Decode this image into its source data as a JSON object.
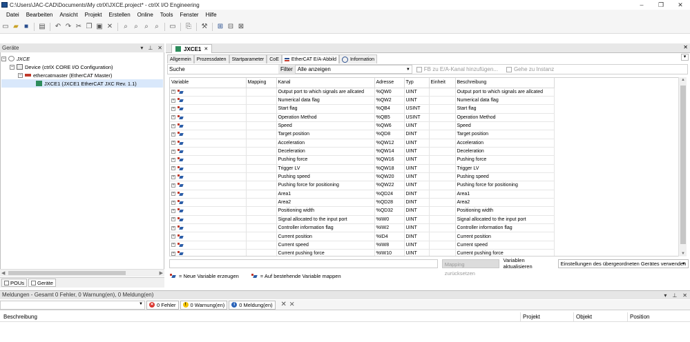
{
  "window": {
    "title": "C:\\Users\\JAC-CAD\\Documents\\My ctrlX\\JXCE.project* - ctrlX I/O Engineering",
    "controls": [
      "–",
      "❐",
      "✕"
    ]
  },
  "menu": [
    "Datei",
    "Bearbeiten",
    "Ansicht",
    "Projekt",
    "Erstellen",
    "Online",
    "Tools",
    "Fenster",
    "Hilfe"
  ],
  "devices_pane": {
    "title": "Geräte",
    "tree": [
      {
        "label": "JXCE",
        "icon": "project-icon"
      },
      {
        "label": "Device (ctrlX CORE I/O Configuration)",
        "icon": "device-icon"
      },
      {
        "label": "ethercatmaster (EtherCAT Master)",
        "icon": "ethercat-master-icon"
      },
      {
        "label": "JXCE1 (JXCE1 EtherCAT JXC Rev. 1.1)",
        "icon": "slave-icon"
      }
    ],
    "bottom_tabs": [
      "POUs",
      "Geräte"
    ]
  },
  "editor": {
    "doc_tab": "JXCE1",
    "subtabs": [
      "Allgemein",
      "Prozessdaten",
      "Startparameter",
      "CoE",
      "EtherCAT E/A-Abbild",
      "Information"
    ],
    "active_subtab": "EtherCAT E/A-Abbild",
    "search_label": "Suche",
    "filter_label": "Filter",
    "filter_value": "Alle anzeigen",
    "add_fb_button": "FB zu E/A-Kanal hinzufügen...",
    "goto_instance_button": "Gehe zu Instanz",
    "columns": [
      "Variable",
      "Mapping",
      "Kanal",
      "Adresse",
      "Typ",
      "Einheit",
      "Beschreibung"
    ],
    "rows": [
      {
        "kanal": "Output port to which signals are allcated",
        "adresse": "%QW0",
        "typ": "UINT",
        "beschreibung": "Output port to which signals are allcated"
      },
      {
        "kanal": "Numerical data flag",
        "adresse": "%QW2",
        "typ": "UINT",
        "beschreibung": "Numerical data flag"
      },
      {
        "kanal": "Start flag",
        "adresse": "%QB4",
        "typ": "USINT",
        "beschreibung": "Start flag"
      },
      {
        "kanal": "Operation Method",
        "adresse": "%QB5",
        "typ": "USINT",
        "beschreibung": "Operation Method"
      },
      {
        "kanal": "Speed",
        "adresse": "%QW6",
        "typ": "UINT",
        "beschreibung": "Speed"
      },
      {
        "kanal": "Target position",
        "adresse": "%QD8",
        "typ": "DINT",
        "beschreibung": "Target position"
      },
      {
        "kanal": "Acceleration",
        "adresse": "%QW12",
        "typ": "UINT",
        "beschreibung": "Acceleration"
      },
      {
        "kanal": "Deceleration",
        "adresse": "%QW14",
        "typ": "UINT",
        "beschreibung": "Deceleration"
      },
      {
        "kanal": "Pushing force",
        "adresse": "%QW16",
        "typ": "UINT",
        "beschreibung": "Pushing force"
      },
      {
        "kanal": "Trigger LV",
        "adresse": "%QW18",
        "typ": "UINT",
        "beschreibung": "Trigger LV"
      },
      {
        "kanal": "Pushing speed",
        "adresse": "%QW20",
        "typ": "UINT",
        "beschreibung": "Pushing speed"
      },
      {
        "kanal": "Pushing force for positioning",
        "adresse": "%QW22",
        "typ": "UINT",
        "beschreibung": "Pushing force for positioning"
      },
      {
        "kanal": "Area1",
        "adresse": "%QD24",
        "typ": "DINT",
        "beschreibung": "Area1"
      },
      {
        "kanal": "Area2",
        "adresse": "%QD28",
        "typ": "DINT",
        "beschreibung": "Area2"
      },
      {
        "kanal": "Positioning width",
        "adresse": "%QD32",
        "typ": "DINT",
        "beschreibung": "Positioning width"
      },
      {
        "kanal": "Signal allocated to the input port",
        "adresse": "%IW0",
        "typ": "UINT",
        "beschreibung": "Signal allocated to the input port"
      },
      {
        "kanal": "Controller information flag",
        "adresse": "%IW2",
        "typ": "UINT",
        "beschreibung": "Controller information flag"
      },
      {
        "kanal": "Current position",
        "adresse": "%ID4",
        "typ": "DINT",
        "beschreibung": "Current position"
      },
      {
        "kanal": "Current speed",
        "adresse": "%IW8",
        "typ": "UINT",
        "beschreibung": "Current speed"
      },
      {
        "kanal": "Current pushing force",
        "adresse": "%IW10",
        "typ": "UINT",
        "beschreibung": "Current pushing force"
      }
    ],
    "reset_mapping_button": "Mapping zurücksetzen",
    "update_vars_label": "Variablen aktualisieren",
    "update_vars_value": "Einstellungen des übergeordneten Gerätes verwenden",
    "legend_new": "= Neue Variable erzeugen",
    "legend_map": "= Auf bestehende Variable mappen"
  },
  "messages": {
    "header": "Meldungen - Gesamt 0 Fehler, 0 Warnung(en), 0 Meldung(en)",
    "errors": "0 Fehler",
    "warnings": "0 Warnung(en)",
    "infos": "0 Meldung(en)",
    "columns": [
      "Beschreibung",
      "Projekt",
      "Objekt",
      "Position"
    ]
  },
  "colors": {
    "error": "#d9322b",
    "warning": "#f2c200",
    "info": "#2a63b9"
  }
}
